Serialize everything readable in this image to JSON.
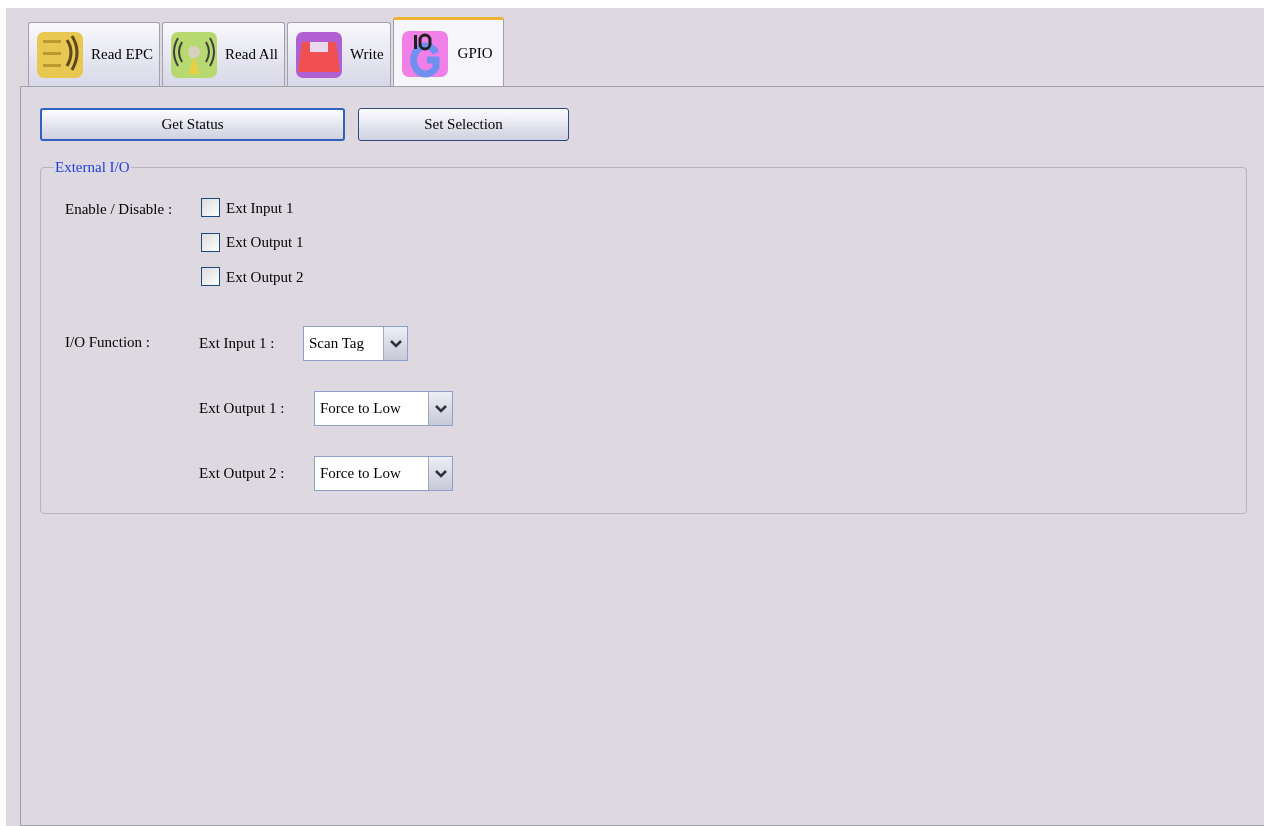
{
  "tabs": [
    {
      "label": "Read EPC",
      "kind": "binary",
      "selected": false
    },
    {
      "label": "Read All",
      "kind": "antenna",
      "selected": false
    },
    {
      "label": "Write",
      "kind": "disk",
      "selected": false
    },
    {
      "label": "GPIO",
      "kind": "gpio",
      "selected": true
    }
  ],
  "buttons": [
    {
      "label": "Get Status",
      "focused": true
    },
    {
      "label": "Set Selection",
      "focused": false
    }
  ],
  "group": {
    "title": "External I/O",
    "enable_label": "Enable / Disable :",
    "checkboxes": [
      {
        "label": "Ext Input 1",
        "checked": false
      },
      {
        "label": "Ext Output 1",
        "checked": false
      },
      {
        "label": "Ext Output 2",
        "checked": false
      }
    ],
    "function_label": "I/O Function :",
    "functions": [
      {
        "label": "Ext Input 1 :",
        "value": "Scan Tag"
      },
      {
        "label": "Ext Output 1 :",
        "value": "Force to Low"
      },
      {
        "label": "Ext Output 2 :",
        "value": "Force to Low"
      }
    ]
  }
}
